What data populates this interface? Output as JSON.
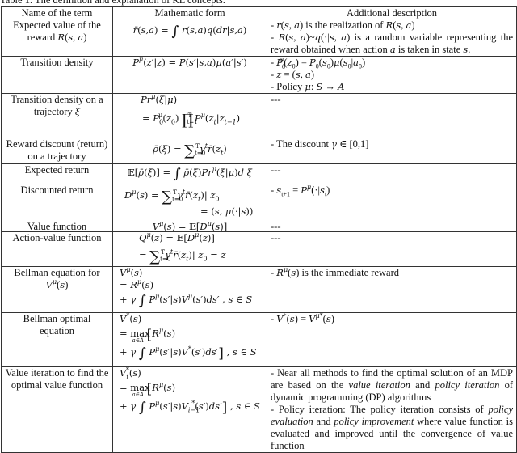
{
  "caption": "Table 1. The definition and explanation of RL concepts.",
  "headers": [
    "Name of the term",
    "Mathematic form",
    "Additional description"
  ],
  "rows": [
    {
      "name": "Expected value of the reward R(s,a)",
      "name_lines": [
        "Expected value of the",
        "reward R(s, a)"
      ],
      "math_lines": [
        "r̄(s,a) = ∫ r(s,a)q(dr|s,a)"
      ],
      "desc_lines": [
        "- r(s,a) is the realization of R(s,a)",
        "- R(s,a)~q(·|s,a) is a random variable representing the reward obtained when action a is taken in state s."
      ]
    },
    {
      "name": "Transition density",
      "name_lines": [
        "Transition density"
      ],
      "math_lines": [
        "P^μ(z′|z) = P(s′|s,a)μ(a′|s′)"
      ],
      "desc_lines": [
        "- P₀^μ(z₀) = P₀(s₀)μ(s₀|a₀)",
        "- z = (s,a)",
        "- Policy μ: S → A"
      ]
    },
    {
      "name": "Transition density on a trajectory ξ",
      "name_lines": [
        "Transition density on a",
        "trajectory ξ"
      ],
      "math_lines": [
        "Pr^μ(ξ|μ)",
        "= P₀^μ(z₀) ∏_{t=1}^{T} P^μ(z_t|z_{t−1})"
      ],
      "desc_lines": [
        "---"
      ]
    },
    {
      "name": "Reward discount (return) on a trajectory",
      "name_lines": [
        "Reward discount (return)",
        "on a trajectory"
      ],
      "math_lines": [
        "ρ̄(ξ) = Σ_{t=0}^{T} γ^t r̄(z_t)"
      ],
      "desc_lines": [
        "- The discount γ ∈ [0,1]"
      ]
    },
    {
      "name": "Expected return",
      "name_lines": [
        "Expected return"
      ],
      "math_lines": [
        "𝔼[ρ̄(ξ)] = ∫ ρ̄(ξ)Pr^μ(ξ|μ)d ξ"
      ],
      "desc_lines": [
        "---"
      ]
    },
    {
      "name": "Discounted return",
      "name_lines": [
        "Discounted return"
      ],
      "math_lines": [
        "D^μ(s) = Σ_{t=0}^{T} γ^t r̄(z_t)| z₀",
        "= (s, μ(·|s))"
      ],
      "desc_lines": [
        "- s_{t+1} = P^μ(·|s_t)"
      ]
    },
    {
      "name": "Value function",
      "name_lines": [
        "Value function"
      ],
      "math_lines": [
        "V^μ(s) = 𝔼[D^μ(s)]"
      ],
      "desc_lines": [
        "---"
      ]
    },
    {
      "name": "Action-value function",
      "name_lines": [
        "Action-value function"
      ],
      "math_lines": [
        "Q^μ(z) = 𝔼[D^μ(z)]",
        "= Σ_{t=0}^{T} γ^t r̄(z_t)| z₀ = z"
      ],
      "desc_lines": [
        "---"
      ]
    },
    {
      "name": "Bellman equation for V^μ(s)",
      "name_lines": [
        "Bellman equation for",
        "V^μ(s)"
      ],
      "math_lines": [
        "V^μ(s)",
        "= R^μ(s)",
        "+ γ ∫ P^μ(s′|s)V^μ(s′)ds′ , s ∈ S"
      ],
      "desc_lines": [
        "- R^μ(s) is the immediate reward"
      ]
    },
    {
      "name": "Bellman optimal equation",
      "name_lines": [
        "Bellman optimal",
        "equation"
      ],
      "math_lines": [
        "V*(s)",
        "= max_{a∈A} [R^μ(s)",
        "+ γ ∫ P^μ(s′|s)V*(s′)ds′] , s ∈ S"
      ],
      "desc_lines": [
        "- V*(s) = V^{μ*}(s)"
      ]
    },
    {
      "name": "Value iteration to find the optimal value function",
      "name_lines": [
        "Value iteration to find the",
        "optimal value function"
      ],
      "math_lines": [
        "V_i*(s)",
        "= max_{a∈A} [R^μ(s)",
        "+ γ ∫ P^μ(s′|s)V_{i−1}*(s′)ds′] , s ∈ S"
      ],
      "desc_lines": [
        "- Near all methods to find the optimal solution of an MDP are based on the value iteration and policy iteration of dynamic programming (DP) algorithms",
        "- Policy iteration: The policy iteration consists of policy evaluation and policy improvement where value function is evaluated and improved until the convergence of value function"
      ],
      "desc_parts": {
        "p1_a": "- Near all methods to find the optimal solution of an MDP are based on the ",
        "p1_em1": "value iteration",
        "p1_b": " and ",
        "p1_em2": "policy iteration",
        "p1_c": " of dynamic programming (DP) algorithms",
        "p2_a": "- Policy iteration: The policy iteration consists of ",
        "p2_em1": "policy evaluation",
        "p2_b": " and ",
        "p2_em2": "policy improvement",
        "p2_c": " where value function is evaluated and improved until the convergence of value function"
      }
    }
  ]
}
